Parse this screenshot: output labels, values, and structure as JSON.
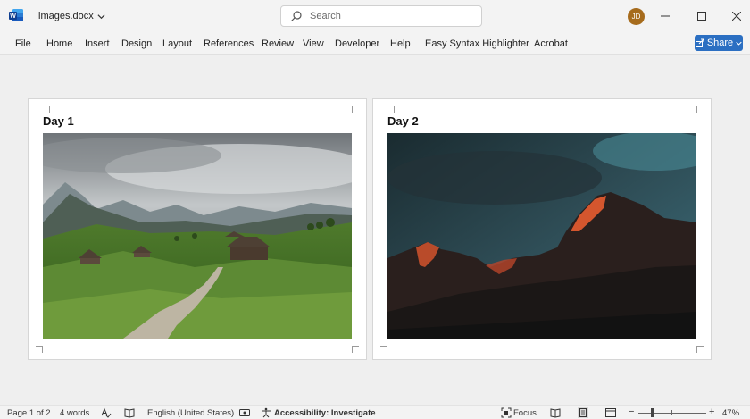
{
  "titlebar": {
    "doc_name": "images.docx",
    "search_placeholder": "Search",
    "avatar_initials": "JD",
    "word_icon": "word-logo-icon",
    "min_icon": "minimize-icon",
    "max_icon": "maximize-icon",
    "close_icon": "close-icon"
  },
  "ribbon": {
    "tabs": [
      "File",
      "Home",
      "Insert",
      "Design",
      "Layout",
      "References",
      "Review",
      "View",
      "Developer",
      "Help",
      "Easy Syntax Highlighter",
      "Acrobat"
    ],
    "share_label": "Share"
  },
  "pages": [
    {
      "heading": "Day 1",
      "image": "mountain-valley-cabins-photo"
    },
    {
      "heading": "Day 2",
      "image": "mountain-sunset-peaks-photo"
    }
  ],
  "statusbar": {
    "page_info": "Page 1 of 2",
    "word_count": "4 words",
    "language": "English (United States)",
    "accessibility": "Accessibility: Investigate",
    "focus": "Focus",
    "zoom": "47%",
    "zoom_minus": "−",
    "zoom_plus": "+"
  },
  "colors": {
    "share_button": "#2b6fc2",
    "avatar": "#a66b1c",
    "word_logo": "#185abd"
  }
}
